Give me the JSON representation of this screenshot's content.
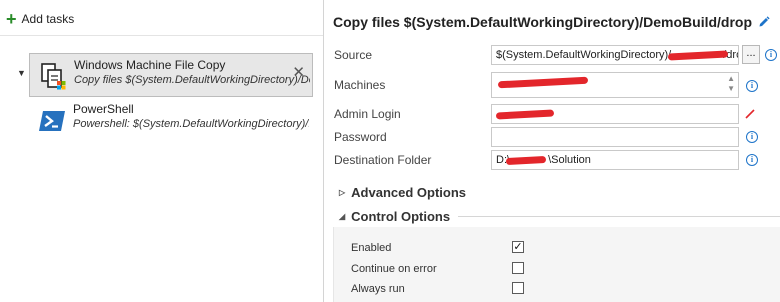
{
  "toolbar": {
    "add_tasks_label": "Add tasks"
  },
  "tasks": [
    {
      "name": "Windows Machine File Copy",
      "description": "Copy files $(System.DefaultWorkingDirectory)/DemoBuild/drop",
      "icon": "file-copy-icon",
      "selected": true
    },
    {
      "name": "PowerShell",
      "description": "Powershell: $(System.DefaultWorkingDirectory)/DemoBuild/drop",
      "icon": "powershell-icon",
      "selected": false
    }
  ],
  "editor": {
    "title": "Copy files $(System.DefaultWorkingDirectory)/DemoBuild/drop",
    "fields": {
      "source": {
        "label": "Source",
        "value": "$(System.DefaultWorkingDirectory)/",
        "value_tail": "/drop"
      },
      "machines": {
        "label": "Machines",
        "value": ""
      },
      "admin_login": {
        "label": "Admin Login",
        "value": ""
      },
      "password": {
        "label": "Password",
        "value": ""
      },
      "destination_folder": {
        "label": "Destination Folder",
        "value_prefix": "D:\\",
        "value_suffix": "\\Solution"
      }
    },
    "browse_label": "...",
    "advanced_options_label": "Advanced Options",
    "control_options_label": "Control Options",
    "control_options": [
      {
        "label": "Enabled",
        "checked": true
      },
      {
        "label": "Continue on error",
        "checked": false
      },
      {
        "label": "Always run",
        "checked": false
      }
    ]
  },
  "colors": {
    "accent": "#1e74c9",
    "add_green": "#2a8c2a",
    "redaction": "#e3262b",
    "selected_bg": "#e7e7e7"
  }
}
